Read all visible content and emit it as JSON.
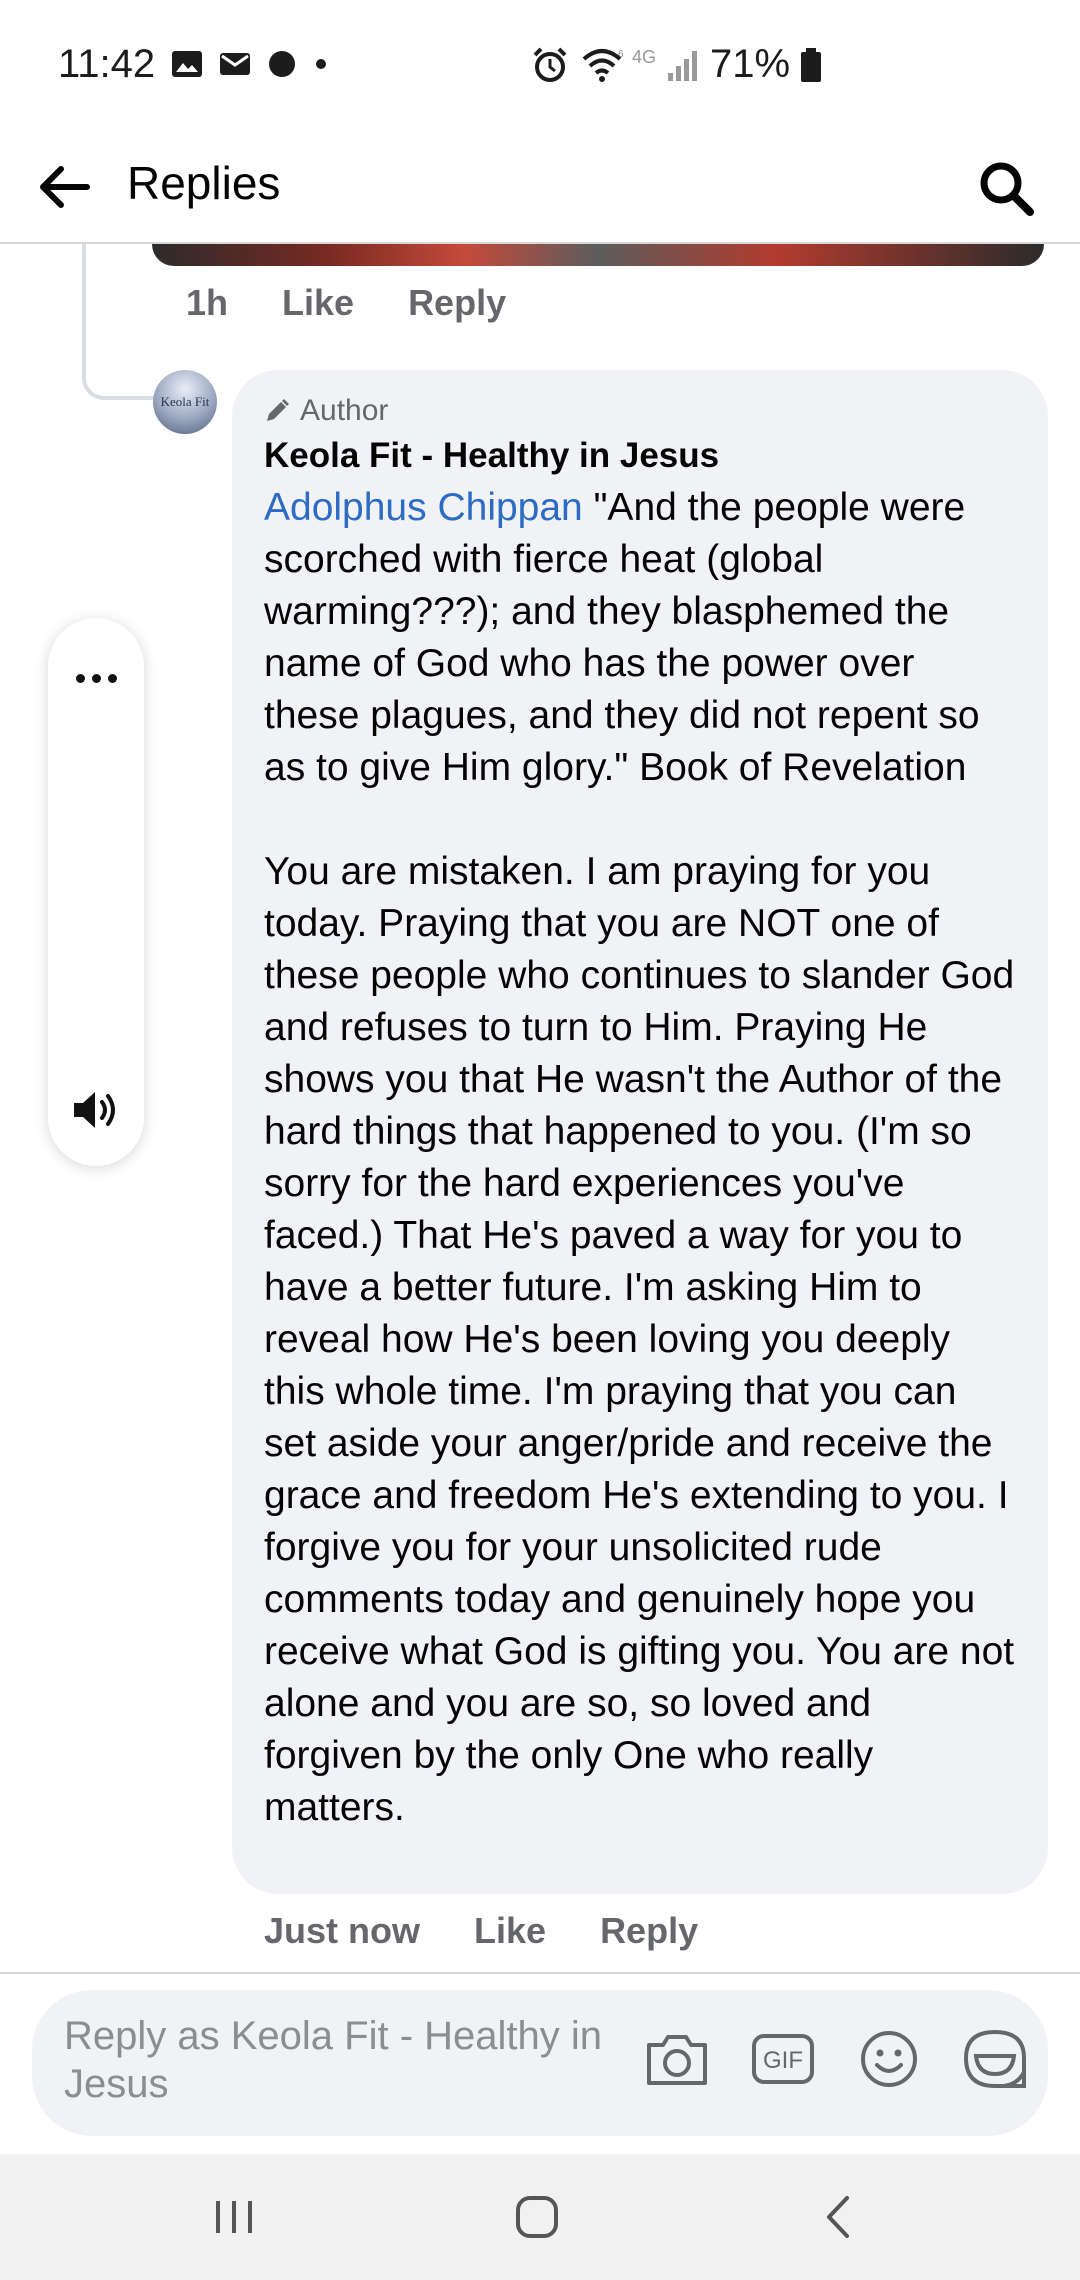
{
  "status_bar": {
    "time": "11:42",
    "battery": "71%",
    "network": "4G"
  },
  "header": {
    "title": "Replies"
  },
  "previous_comment": {
    "timestamp": "1h",
    "like_label": "Like",
    "reply_label": "Reply"
  },
  "comment": {
    "avatar_text": "Keola Fit",
    "badge": "Author",
    "author_name": "Keola Fit - Healthy in Jesus",
    "mention": "Adolphus Chippan",
    "text": " \"And the people were scorched with fierce heat (global warming???); and they blasphemed the name of God who has the power over these plagues, and they did not repent so as to give Him glory.\" Book of Revelation\n\nYou are mistaken. I am praying for you today. Praying that you are NOT one of these people who continues to slander God and refuses to turn to Him. Praying He shows you that He wasn't the Author of the hard things that happened to you. (I'm so sorry for the hard experiences you've faced.) That He's paved a way for you to have a better future. I'm asking Him to reveal how He's been loving you deeply this whole time. I'm praying that you can set aside your anger/pride and receive the grace and freedom He's extending to you. I forgive you for your unsolicited rude comments today and genuinely hope you receive what God is gifting you. You are not alone and you are so, so loved and forgiven by the only One who really matters.",
    "timestamp": "Just now",
    "like_label": "Like",
    "reply_label": "Reply"
  },
  "composer": {
    "placeholder": "Reply as Keola Fit - Healthy in Jesus",
    "gif_label": "GIF",
    "icons": [
      "camera-icon",
      "gif-icon",
      "emoji-icon",
      "sticker-icon"
    ]
  },
  "colors": {
    "mention": "#2d6bc4",
    "bubble": "#f0f2f5",
    "secondary_text": "#65676b"
  }
}
